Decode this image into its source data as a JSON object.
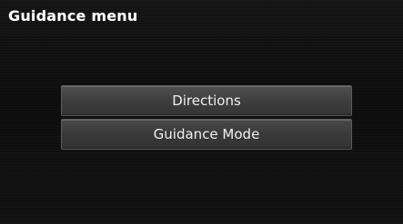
{
  "screen": {
    "title": "Guidance menu"
  },
  "menu": {
    "items": [
      {
        "label": "Directions"
      },
      {
        "label": "Guidance Mode"
      }
    ]
  }
}
